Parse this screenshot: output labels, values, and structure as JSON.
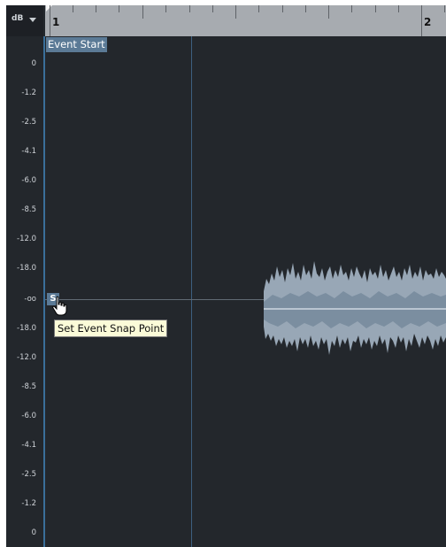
{
  "header": {
    "scale_unit": "dB"
  },
  "ruler": {
    "bars": [
      "1",
      "2"
    ]
  },
  "scale": {
    "labels": [
      "0",
      "-1.2",
      "-2.5",
      "-4.1",
      "-6.0",
      "-8.5",
      "-12.0",
      "-18.0",
      "-oo",
      "-18.0",
      "-12.0",
      "-8.5",
      "-6.0",
      "-4.1",
      "-2.5",
      "-1.2",
      "0"
    ]
  },
  "event": {
    "start_label": "Event Start",
    "snap_handle_label": "S"
  },
  "tooltip": {
    "text": "Set Event Snap Point"
  },
  "icons": {
    "scale_dropdown": "chevron-down-icon",
    "cursor": "hand-pointer-icon",
    "ruler_marker": "event-start-marker-icon"
  },
  "colors": {
    "background": "#23272c",
    "ruler": "#a7abb0",
    "event_label": "#5b7a96",
    "waveform": "#98a7b6",
    "tooltip_bg": "#fbfbd8"
  }
}
